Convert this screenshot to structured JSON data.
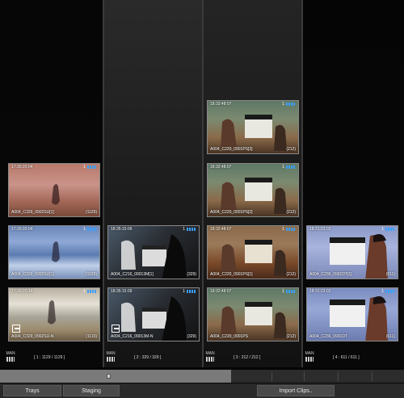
{
  "columns": [
    {
      "id": 1,
      "count_label": "[ 1 : 1129 / 1129 ]",
      "footer_icon": "MAN",
      "clips": [
        {
          "timecode": "17:30:20:04",
          "channel": "1",
          "name": "A004_C329_0902SU[1]",
          "count": "(1129)",
          "scene": "beach-sunset-warm"
        },
        {
          "timecode": "17:30:20:04",
          "channel": "1",
          "name": "A004_C329_0902SU[1]",
          "count": "(1129)",
          "scene": "beach-sunset-blue"
        },
        {
          "timecode": "17:30:20:14",
          "channel": "1",
          "name": "A004_C329_0902SU-N",
          "count": "(1119)",
          "scene": "beach-bright",
          "marked": true
        }
      ]
    },
    {
      "id": 2,
      "count_label": "[ 2 : 329 / 329 ]",
      "footer_icon": "MAN",
      "clips": [
        {
          "timecode": "18:35:15:09",
          "channel": "1",
          "name": "A004_C216_09013M[1]",
          "count": "(329)",
          "scene": "clapper-dark"
        },
        {
          "timecode": "18:35:15:09",
          "channel": "1",
          "name": "A004_C216_09013M-N",
          "count": "(329)",
          "scene": "clapper-dark",
          "marked": true
        }
      ]
    },
    {
      "id": 3,
      "count_label": "[ 3 : 212 / 212 ]",
      "footer_icon": "MAN",
      "clips": [
        {
          "timecode": "18:32:48:07",
          "channel": "1",
          "name": "A004_C220_0901PS[3]",
          "count": "(212)",
          "scene": "clapper-warm"
        },
        {
          "timecode": "18:32:48:07",
          "channel": "1",
          "name": "A004_C220_0901PS[2]",
          "count": "(212)",
          "scene": "clapper-warm"
        },
        {
          "timecode": "18:32:48:07",
          "channel": "1",
          "name": "A004_C220_0901PS[1]",
          "count": "(212)",
          "scene": "clapper-warm"
        },
        {
          "timecode": "18:32:48:07",
          "channel": "1",
          "name": "A004_C220_0901PS",
          "count": "(212)",
          "scene": "clapper-warm"
        }
      ]
    },
    {
      "id": 4,
      "count_label": "[ 4 : 611 / 611 ]",
      "footer_icon": "MAN",
      "clips": [
        {
          "timecode": "18:31:23:02",
          "channel": "1",
          "name": "A004_C236_0901DT[1]",
          "count": "(611)",
          "scene": "clapper-face"
        },
        {
          "timecode": "18:31:23:02",
          "channel": "1",
          "name": "A004_C236_0901DT",
          "count": "(611)",
          "scene": "clapper-face"
        }
      ]
    }
  ],
  "toolbar": {
    "trays_label": "Trays",
    "staging_label": "Staging",
    "import_label": "Import Clips.."
  }
}
